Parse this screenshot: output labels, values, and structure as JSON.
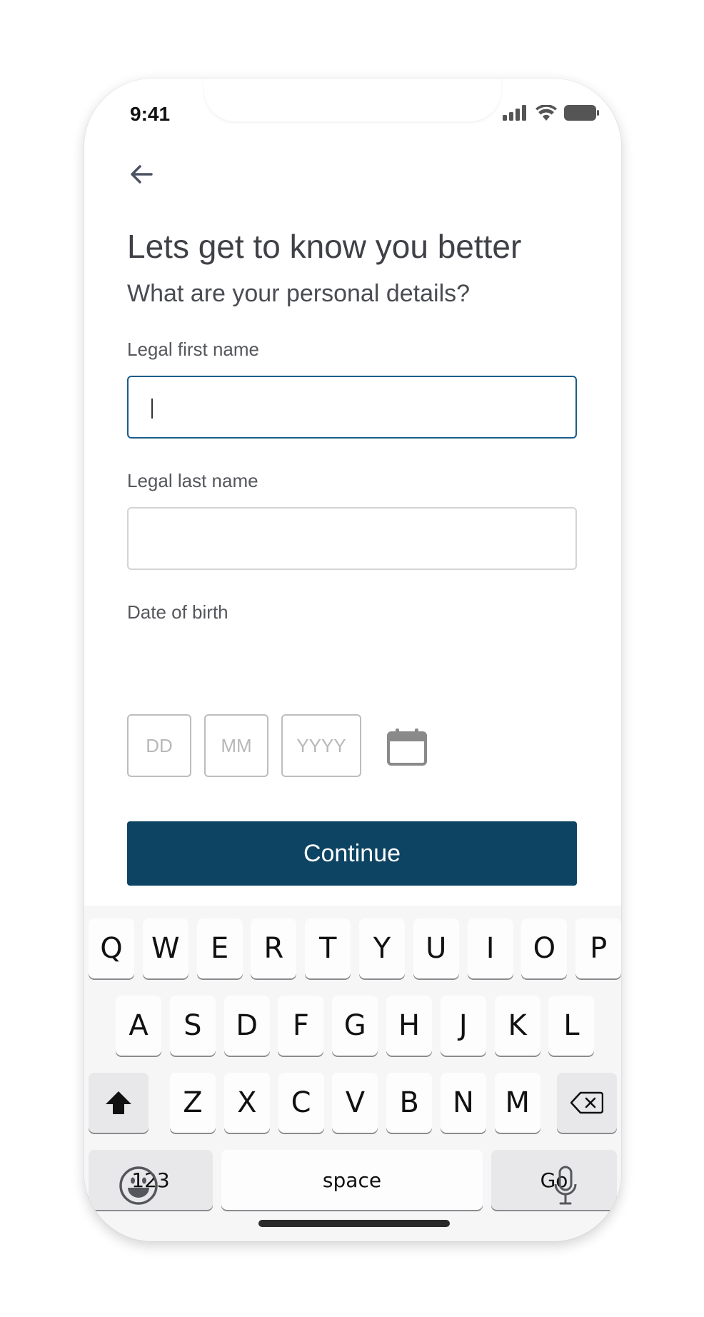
{
  "status_bar": {
    "time": "9:41"
  },
  "header": {
    "title": "Lets get to know you better",
    "subtitle": "What are your personal details?"
  },
  "form": {
    "first_name": {
      "label": "Legal first name",
      "value": ""
    },
    "last_name": {
      "label": "Legal last name",
      "value": ""
    },
    "dob": {
      "label": "Date of birth",
      "day_placeholder": "DD",
      "month_placeholder": "MM",
      "year_placeholder": "YYYY"
    },
    "continue_label": "Continue"
  },
  "keyboard": {
    "row1": [
      "Q",
      "W",
      "E",
      "R",
      "T",
      "Y",
      "U",
      "I",
      "O",
      "P"
    ],
    "row2": [
      "A",
      "S",
      "D",
      "F",
      "G",
      "H",
      "J",
      "K",
      "L"
    ],
    "row3": [
      "Z",
      "X",
      "C",
      "V",
      "B",
      "N",
      "M"
    ],
    "numbers_label": "123",
    "space_label": "space",
    "go_label": "Go"
  },
  "colors": {
    "accent": "#0d4463",
    "focus_border": "#1b5c8a"
  }
}
